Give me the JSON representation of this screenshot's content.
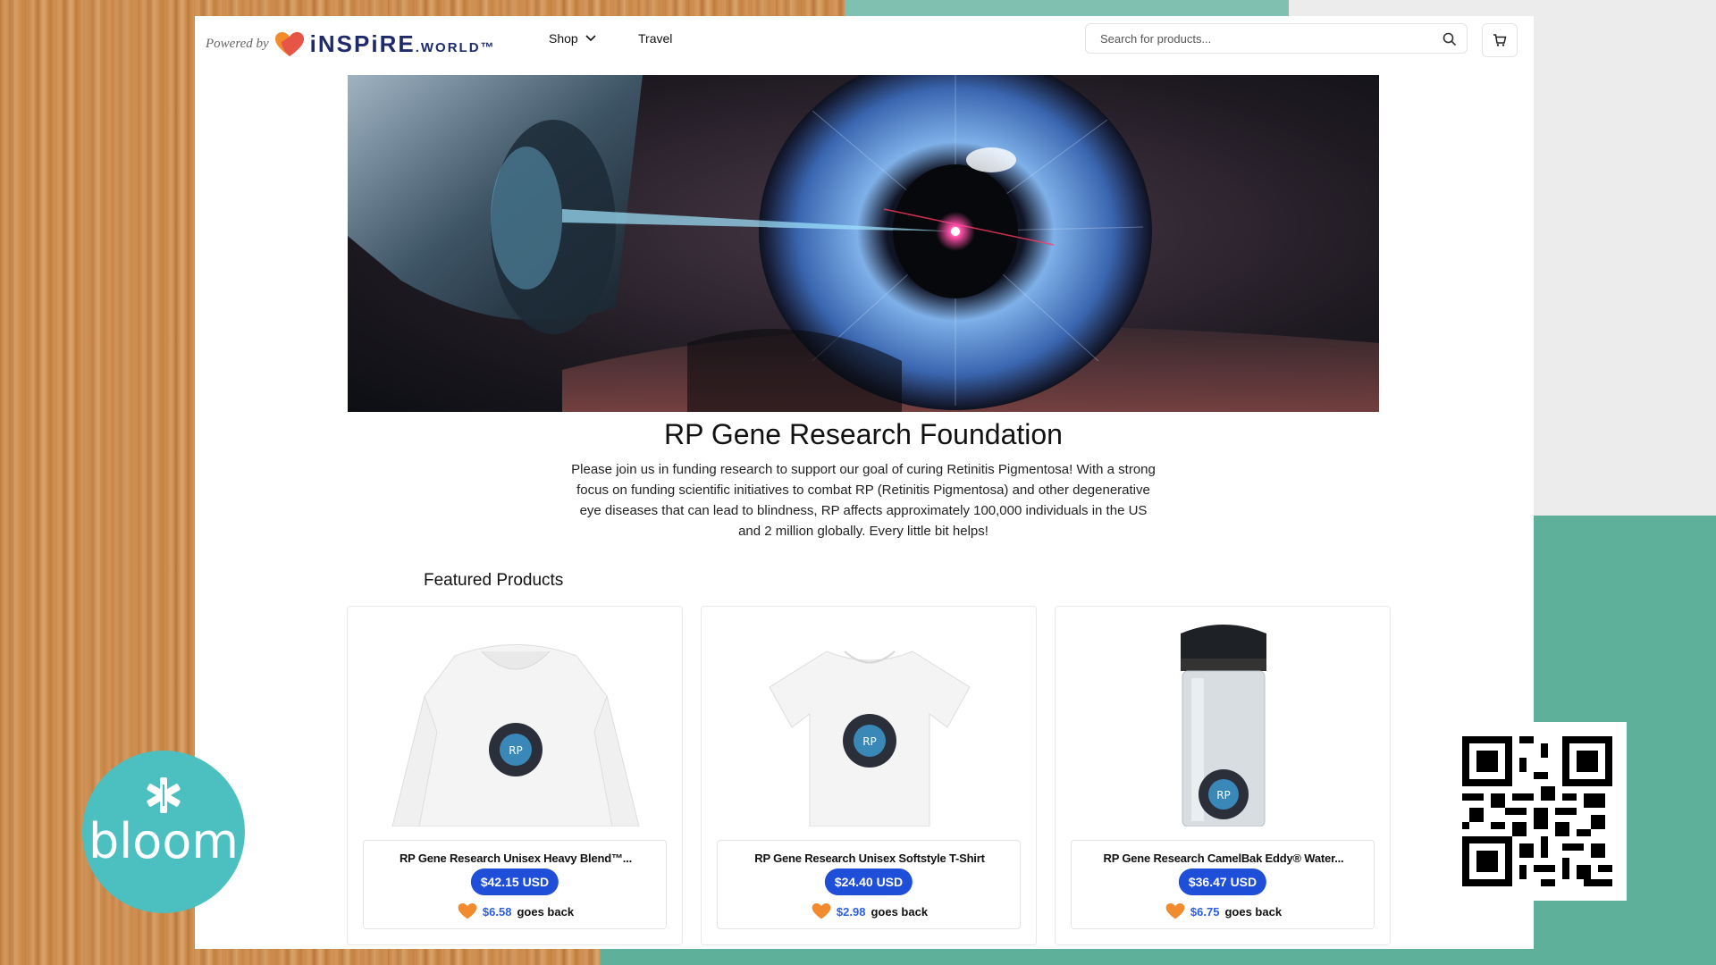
{
  "header": {
    "powered_by": "Powered by",
    "brand_main": "iNSPiRE",
    "brand_suffix": ".WORLD",
    "brand_tm": "™",
    "nav": {
      "shop": "Shop",
      "travel": "Travel"
    },
    "search_placeholder": "Search for products..."
  },
  "hero": {
    "title": "RP Gene Research Foundation",
    "description": "Please join us in funding research to support our goal of curing Retinitis Pigmentosa! With a strong focus on funding scientific initiatives to combat RP (Retinitis Pigmentosa) and other degenerative eye diseases that can lead to blindness, RP affects approximately 100,000 individuals in the US and 2 million globally. Every little bit helps!"
  },
  "featured": {
    "heading": "Featured Products",
    "products": [
      {
        "name": "RP Gene Research Unisex Heavy Blend™...",
        "price": "$42.15 USD",
        "goes_back_amount": "$6.58",
        "goes_back_label": "goes back"
      },
      {
        "name": "RP Gene Research Unisex Softstyle T-Shirt",
        "price": "$24.40 USD",
        "goes_back_amount": "$2.98",
        "goes_back_label": "goes back"
      },
      {
        "name": "RP Gene Research CamelBak Eddy® Water...",
        "price": "$36.47 USD",
        "goes_back_amount": "$6.75",
        "goes_back_label": "goes back"
      }
    ]
  },
  "overlay": {
    "bloom_text": "bloom"
  },
  "colors": {
    "price_pill": "#1f4ed8",
    "brand_navy": "#1f2a6b",
    "bloom_teal": "#4cbfc0",
    "goes_back_blue": "#2d5fe0"
  }
}
